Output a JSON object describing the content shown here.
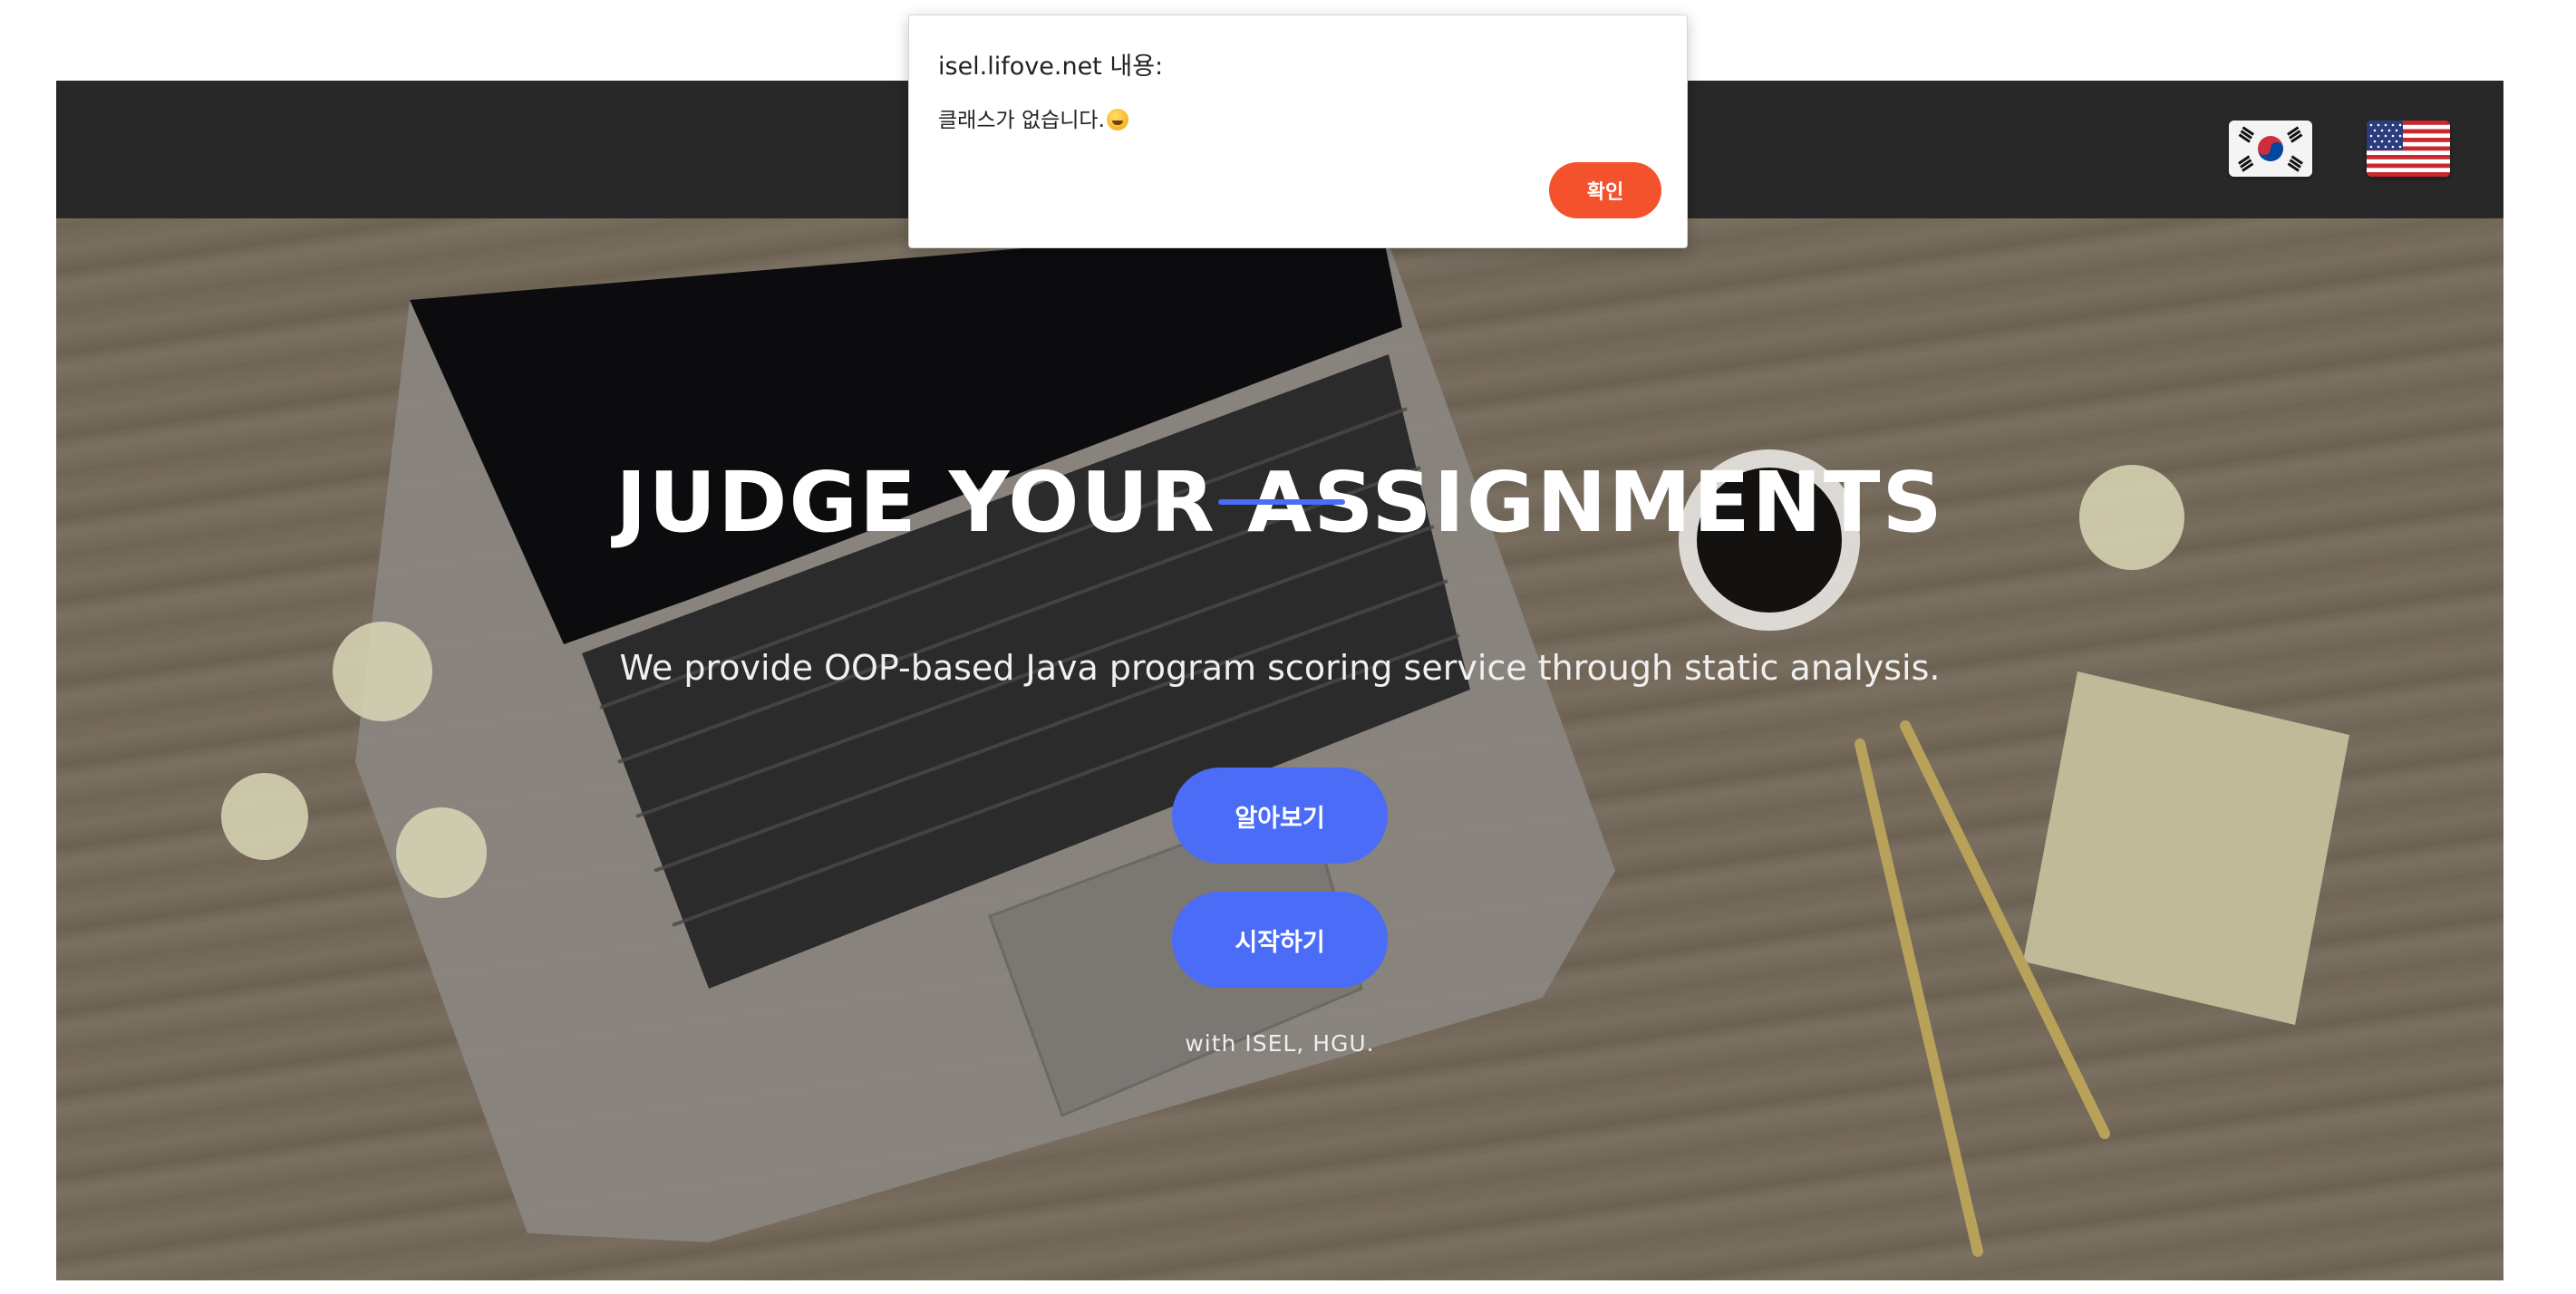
{
  "dialog": {
    "title": "isel.lifove.net 내용:",
    "message": "클래스가 없습니다.",
    "emoji_icon": "grinning-sweat-emoji",
    "ok_label": "확인"
  },
  "topbar": {
    "flags": [
      {
        "name": "korea-flag-icon",
        "label": "Korean"
      },
      {
        "name": "usa-flag-icon",
        "label": "English"
      }
    ]
  },
  "hero": {
    "title": "JUDGE YOUR ASSIGNMENTS",
    "subtitle": "We provide OOP-based Java program scoring service through static analysis.",
    "learn_more_label": "알아보기",
    "start_label": "시작하기",
    "credit": "with ISEL, HGU."
  },
  "colors": {
    "topbar_bg": "#282828",
    "primary_button": "#4a6cf7",
    "dialog_ok_button": "#f4522d",
    "title_underline": "#4a6cf7"
  }
}
